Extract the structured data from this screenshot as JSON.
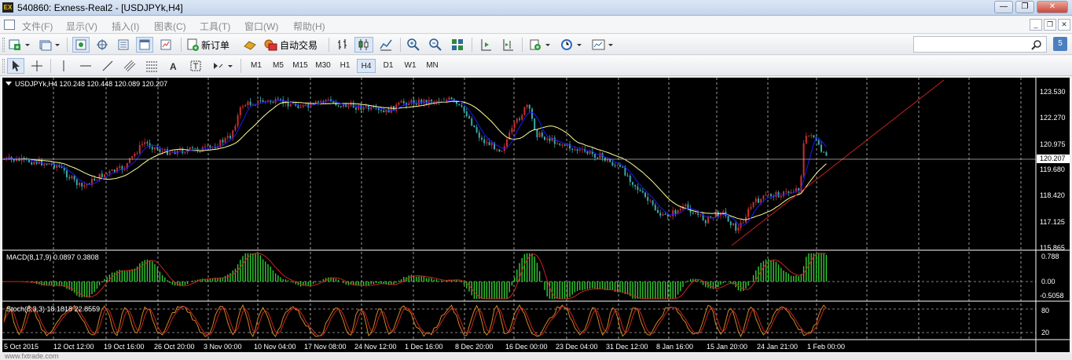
{
  "window": {
    "logo_text": "EX",
    "title": "540860: Exness-Real2 - [USDJPYk,H4]",
    "controls": [
      "—",
      "❐",
      "✕"
    ]
  },
  "menu": {
    "items": [
      "文件(F)",
      "显示(V)",
      "插入(I)",
      "图表(C)",
      "工具(T)",
      "窗口(W)",
      "帮助(H)"
    ],
    "mdi_controls": [
      "_",
      "❐",
      "✕"
    ]
  },
  "toolbar": {
    "new_order_label": "新订单",
    "auto_trading_label": "自动交易",
    "search_placeholder": "",
    "help_label": "5"
  },
  "timeframes": [
    "M1",
    "M5",
    "M15",
    "M30",
    "H1",
    "H4",
    "D1",
    "W1",
    "MN"
  ],
  "active_timeframe": "H4",
  "chart": {
    "header": "USDJPYk,H4  120.248 120.448 120.089 120.207",
    "current_price": "120.207",
    "price_axis": [
      "123.530",
      "122.270",
      "120.975",
      "119.680",
      "118.420",
      "117.125",
      "115.865"
    ],
    "macd_header": "MACD(8,17,9) 0.0897 0.3808",
    "macd_axis": [
      "0.788",
      "0.00",
      "-0.5058"
    ],
    "stoch_header": "Stoch(8,3,3) 18.1818 22.8559",
    "stoch_axis": [
      "80",
      "20"
    ],
    "time_axis": [
      "5 Oct 2015",
      "12 Oct 12:00",
      "19 Oct 16:00",
      "26 Oct 20:00",
      "3 Nov 00:00",
      "10 Nov 04:00",
      "17 Nov 08:00",
      "24 Nov 12:00",
      "1 Dec 16:00",
      "8 Dec 20:00",
      "16 Dec 00:00",
      "23 Dec 04:00",
      "31 Dec 12:00",
      "8 Jan 16:00",
      "15 Jan 20:00",
      "24 Jan 21:00",
      "1 Feb 00:00"
    ],
    "colors": {
      "background": "#000000",
      "bull": "#c83030",
      "bear": "#3aa8a8",
      "ma_fast": "#1a1aff",
      "ma_slow": "#ffff99",
      "trendline": "#c82020",
      "macd_hist": "#33cc33",
      "macd_signal": "#cc2222",
      "stoch_main": "#cc8822",
      "stoch_signal": "#cc2222",
      "grid": "#ffffff"
    }
  },
  "status": {
    "watermark": "www.fxtrade.com"
  }
}
